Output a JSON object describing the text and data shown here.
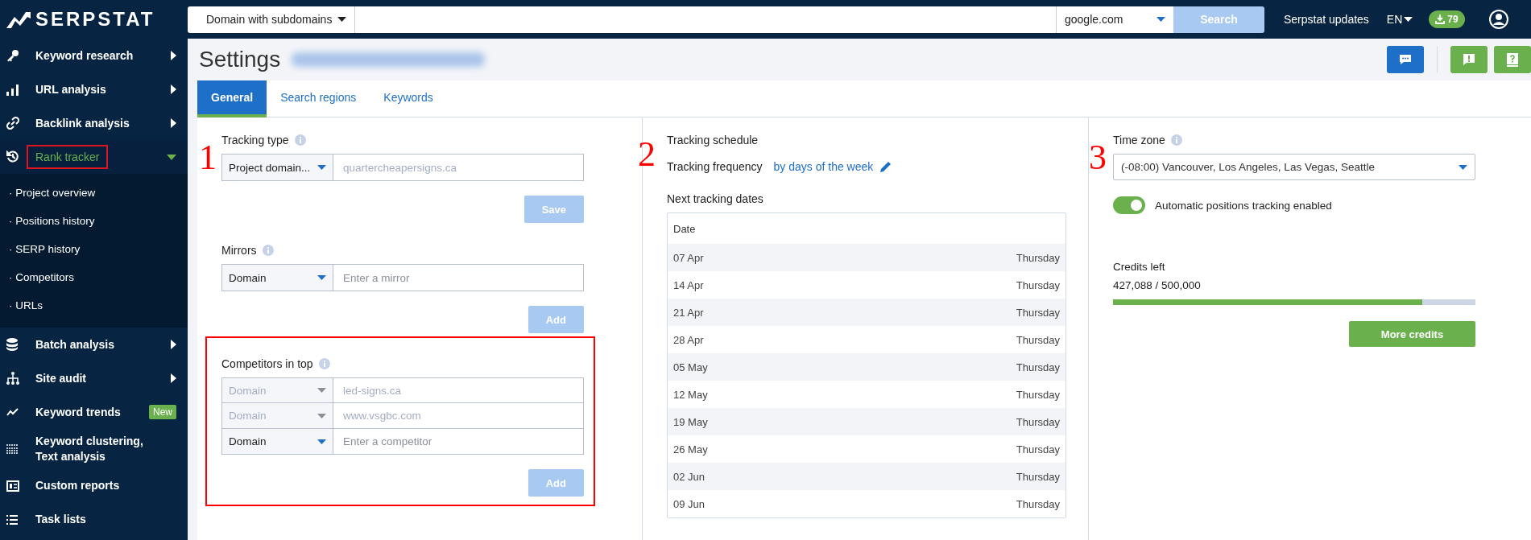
{
  "topbar": {
    "logo": "SERPSTAT",
    "search_type": "Domain with subdomains",
    "engine": "google.com",
    "search_button": "Search",
    "updates": "Serpstat updates",
    "language": "EN",
    "downloads": "79"
  },
  "sidebar": {
    "items": [
      {
        "label": "Keyword research",
        "kind": "menu",
        "selected": false,
        "expanded": false
      },
      {
        "label": "URL analysis",
        "kind": "menu",
        "selected": false,
        "expanded": false
      },
      {
        "label": "Backlink analysis",
        "kind": "menu",
        "selected": false,
        "expanded": false
      },
      {
        "label": "Rank tracker",
        "kind": "menu",
        "selected": true,
        "expanded": true,
        "highlighted": true,
        "children": [
          "· Project overview",
          "· Positions history",
          "· SERP history",
          "· Competitors",
          "· URLs"
        ]
      },
      {
        "label": "Batch analysis",
        "kind": "menu",
        "selected": false,
        "expanded": false
      },
      {
        "label": "Site audit",
        "kind": "menu",
        "selected": false,
        "expanded": false
      },
      {
        "label": "Keyword trends",
        "kind": "link",
        "selected": false,
        "badge": "New"
      },
      {
        "label": "Keyword clustering, Text analysis",
        "kind": "link",
        "selected": false
      },
      {
        "label": "Custom reports",
        "kind": "link",
        "selected": false
      },
      {
        "label": "Task lists",
        "kind": "link",
        "selected": false
      }
    ]
  },
  "page": {
    "title": "Settings"
  },
  "tabs": [
    {
      "label": "General",
      "selected": true
    },
    {
      "label": "Search regions",
      "selected": false
    },
    {
      "label": "Keywords",
      "selected": false
    }
  ],
  "general": {
    "annotations": [
      "1",
      "2",
      "3"
    ],
    "tracking_type": {
      "label": "Tracking type",
      "select": "Project domain...",
      "value": "quartercheapersigns.ca",
      "button": "Save"
    },
    "mirrors": {
      "label": "Mirrors",
      "select": "Domain",
      "placeholder": "Enter a mirror",
      "button": "Add"
    },
    "competitors": {
      "label": "Competitors in top",
      "highlighted": true,
      "rows": [
        {
          "select": "Domain",
          "value": "led-signs.ca",
          "disabled": true
        },
        {
          "select": "Domain",
          "value": "www.vsgbc.com",
          "disabled": true
        },
        {
          "select": "Domain",
          "placeholder": "Enter a competitor",
          "disabled": false
        }
      ],
      "button": "Add"
    },
    "schedule": {
      "label": "Tracking schedule",
      "frequency_label": "Tracking frequency",
      "frequency": "by days of the week",
      "next_label": "Next tracking dates",
      "table": {
        "columns": [
          "Date"
        ],
        "rows": [
          [
            "07 Apr",
            "Thursday"
          ],
          [
            "14 Apr",
            "Thursday"
          ],
          [
            "21 Apr",
            "Thursday"
          ],
          [
            "28 Apr",
            "Thursday"
          ],
          [
            "05 May",
            "Thursday"
          ],
          [
            "12 May",
            "Thursday"
          ],
          [
            "19 May",
            "Thursday"
          ],
          [
            "26 May",
            "Thursday"
          ],
          [
            "02 Jun",
            "Thursday"
          ],
          [
            "09 Jun",
            "Thursday"
          ]
        ]
      }
    },
    "timezone": {
      "label": "Time zone",
      "value": "(-08:00) Vancouver, Los Angeles, Las Vegas, Seattle"
    },
    "auto_tracking": {
      "label": "Automatic positions tracking enabled",
      "on": true
    },
    "credits": {
      "label": "Credits left",
      "reading": "427,088 / 500,000",
      "level": 0.854,
      "button": "More credits"
    }
  }
}
